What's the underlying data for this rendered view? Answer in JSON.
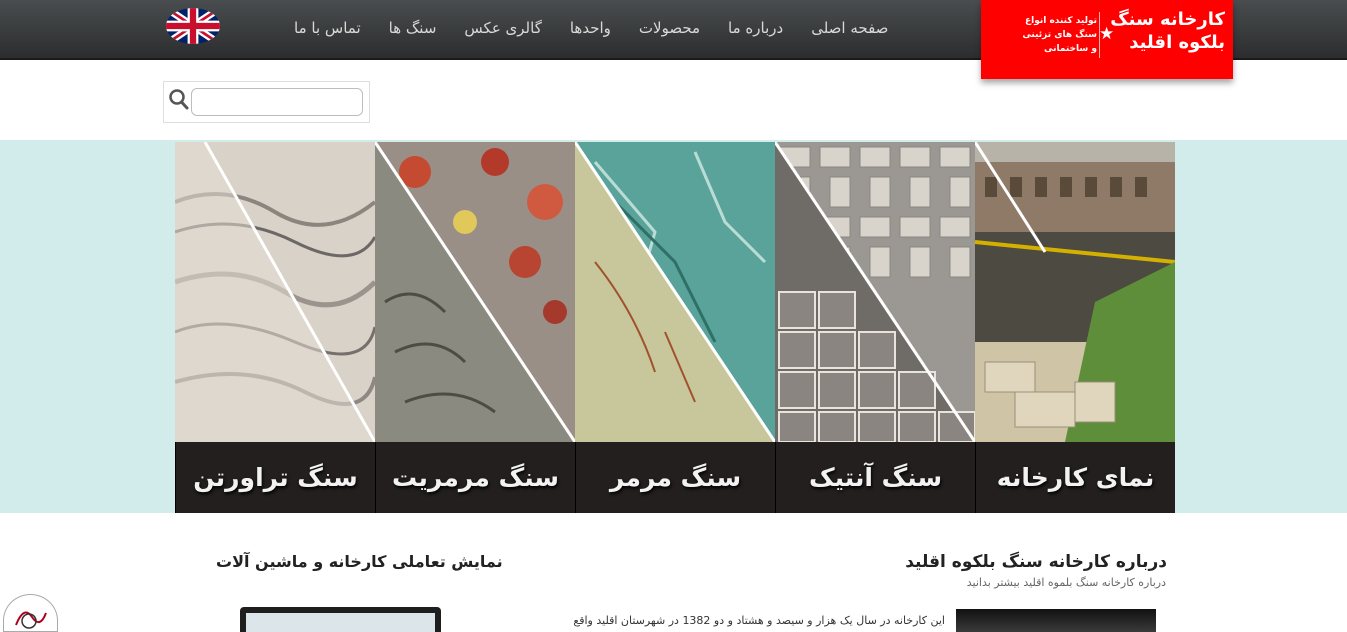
{
  "brand": {
    "name_line1": "کارخانه سنگ",
    "name_line2": "بلکوه اقلید",
    "tagline_line1": "تولید کننده انواع",
    "tagline_line2": "سنگ های تزئینی",
    "tagline_line3": "و ساختمانی",
    "color": "#ff0000"
  },
  "nav": {
    "items": [
      {
        "label": "صفحه اصلی"
      },
      {
        "label": "درباره ما"
      },
      {
        "label": "محصولات"
      },
      {
        "label": "واحدها"
      },
      {
        "label": "گالری عکس"
      },
      {
        "label": "سنگ ها"
      },
      {
        "label": "تماس با ما"
      }
    ],
    "language_icon": "uk-flag-icon"
  },
  "search": {
    "value": "",
    "icon": "search-icon"
  },
  "banner": {
    "tiles": [
      {
        "caption": "نمای کارخانه",
        "image": "factory-photo"
      },
      {
        "caption": "سنگ آنتیک",
        "image": "antique-stone-photo"
      },
      {
        "caption": "سنگ مرمر",
        "image": "marble-photo"
      },
      {
        "caption": "سنگ مرمریت",
        "image": "marmarite-photo"
      },
      {
        "caption": "سنگ تراورتن",
        "image": "travertine-photo"
      }
    ]
  },
  "about": {
    "title": "درباره کارخانه سنگ بلکوه اقلید",
    "subtitle": "درباره کارخانه سنگ بلموه اقلید بیشتر بدانید",
    "text": "این کارخانه در سال یک هزار و سیصد و هشتاد و دو 1382 در شهرستان اقلید واقع"
  },
  "showcase": {
    "title": "نمایش تعاملی کارخانه و ماشین آلات"
  }
}
